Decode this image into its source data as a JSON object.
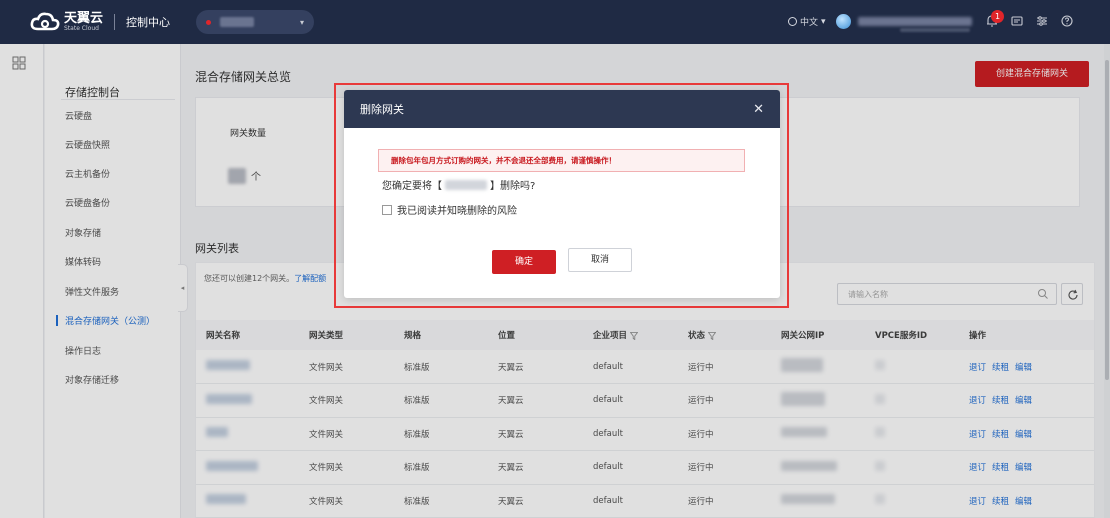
{
  "topbar": {
    "brand_name": "天翼云",
    "brand_sub": "State Cloud",
    "console_label": "控制中心",
    "language_label": "中文"
  },
  "sidebar": {
    "title": "存储控制台",
    "items": [
      {
        "label": "云硬盘"
      },
      {
        "label": "云硬盘快照"
      },
      {
        "label": "云主机备份"
      },
      {
        "label": "云硬盘备份"
      },
      {
        "label": "对象存储"
      },
      {
        "label": "媒体转码"
      },
      {
        "label": "弹性文件服务"
      },
      {
        "label": "混合存储网关（公测）",
        "active": true
      },
      {
        "label": "操作日志"
      },
      {
        "label": "对象存储迁移"
      }
    ]
  },
  "main": {
    "title": "混合存储网关总览",
    "create_button": "创建混合存储网关",
    "summary": {
      "gateway_count_label": "网关数量",
      "unit": "个"
    },
    "list_title": "网关列表",
    "hint_text": "您还可以创建12个网关。",
    "hint_link": "了解配额",
    "search_placeholder": "请输入名称",
    "columns": [
      "网关名称",
      "网关类型",
      "规格",
      "位置",
      "企业项目",
      "状态",
      "网关公网IP",
      "VPCE服务ID",
      "操作"
    ],
    "rows": [
      {
        "type": "文件网关",
        "spec": "标准版",
        "location": "天翼云",
        "project": "default",
        "status": "运行中"
      },
      {
        "type": "文件网关",
        "spec": "标准版",
        "location": "天翼云",
        "project": "default",
        "status": "运行中"
      },
      {
        "type": "文件网关",
        "spec": "标准版",
        "location": "天翼云",
        "project": "default",
        "status": "运行中"
      },
      {
        "type": "文件网关",
        "spec": "标准版",
        "location": "天翼云",
        "project": "default",
        "status": "运行中"
      },
      {
        "type": "文件网关",
        "spec": "标准版",
        "location": "天翼云",
        "project": "default",
        "status": "运行中"
      }
    ],
    "actions": [
      "退订",
      "续租",
      "编辑"
    ]
  },
  "modal": {
    "title": "删除网关",
    "warning": "删除包年包月方式订购的网关，并不会退还全部费用，请谨慎操作！",
    "confirm_prefix": "您确定要将【",
    "confirm_suffix": "】删除吗?",
    "checkbox_label": "我已阅读并知晓删除的风险",
    "ok_label": "确定",
    "cancel_label": "取消"
  },
  "colors": {
    "brand_red": "#cf1f24",
    "topbar_bg": "#1f2a44",
    "link_blue": "#1f6fd8"
  }
}
